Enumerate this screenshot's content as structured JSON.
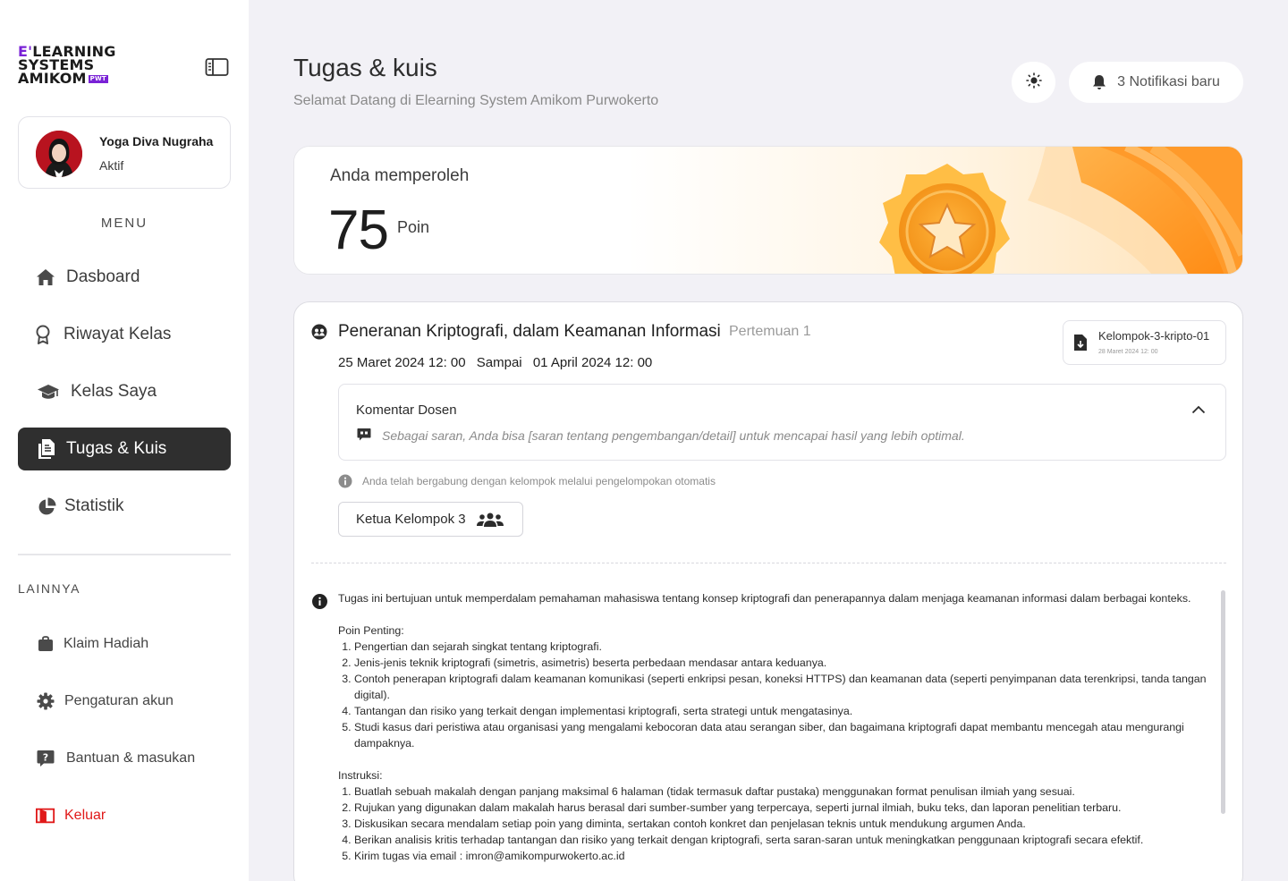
{
  "sidebar": {
    "logo": {
      "line1_prefix": "E'",
      "line1": "LEARNING",
      "line2": "SYSTEMS",
      "line3": "AMIKOM",
      "badge": "PWT"
    },
    "profile": {
      "name": "Yoga Diva Nugraha",
      "status": "Aktif"
    },
    "menu_title": "MENU",
    "nav": [
      {
        "label": "Dasboard",
        "icon": "home-icon"
      },
      {
        "label": "Riwayat Kelas",
        "icon": "award-icon"
      },
      {
        "label": "Kelas Saya",
        "icon": "graduation-cap-icon"
      },
      {
        "label": "Tugas & Kuis",
        "icon": "document-icon",
        "active": true
      },
      {
        "label": "Statistik",
        "icon": "pie-chart-icon"
      }
    ],
    "other_title": "LAINNYA",
    "other": [
      {
        "label": "Klaim Hadiah",
        "icon": "bag-icon"
      },
      {
        "label": "Pengaturan akun",
        "icon": "gear-icon"
      },
      {
        "label": "Bantuan & masukan",
        "icon": "help-icon"
      },
      {
        "label": "Keluar",
        "icon": "logout-icon"
      }
    ]
  },
  "header": {
    "title": "Tugas & kuis",
    "subtitle": "Selamat Datang di Elearning System Amikom Purwokerto",
    "notifications": "3 Notifikasi baru"
  },
  "points": {
    "label": "Anda memperoleh",
    "value": "75",
    "unit": "Poin"
  },
  "task": {
    "title": "Peneranan Kriptografi, dalam Keamanan Informasi",
    "meeting": "Pertemuan 1",
    "start": "25 Maret 2024 12: 00",
    "until": "Sampai",
    "end": "01 April 2024 12: 00",
    "file": {
      "name": "Kelompok-3-kripto-01",
      "date": "28 Maret 2024 12: 00"
    },
    "comment": {
      "title": "Komentar Dosen",
      "text": "Sebagai saran, Anda bisa [saran tentang pengembangan/detail]  untuk mencapai hasil yang lebih optimal."
    },
    "join_info": "Anda telah bergabung dengan kelompok melalui pengelompokan otomatis",
    "role": "Ketua Kelompok 3",
    "description": {
      "intro": "Tugas ini bertujuan untuk memperdalam pemahaman mahasiswa tentang konsep kriptografi dan penerapannya dalam menjaga keamanan informasi dalam berbagai konteks.",
      "points_title": "Poin Penting:",
      "points": [
        "Pengertian dan sejarah singkat tentang kriptografi.",
        "Jenis-jenis teknik kriptografi (simetris, asimetris) beserta perbedaan mendasar antara keduanya.",
        "Contoh penerapan kriptografi dalam keamanan komunikasi (seperti enkripsi pesan, koneksi HTTPS) dan keamanan data (seperti penyimpanan data terenkripsi, tanda tangan digital).",
        "Tantangan dan risiko yang terkait dengan implementasi kriptografi, serta strategi untuk mengatasinya.",
        "Studi kasus dari peristiwa atau organisasi yang mengalami kebocoran data atau serangan siber, dan bagaimana kriptografi dapat membantu mencegah atau mengurangi dampaknya."
      ],
      "instructions_title": "Instruksi:",
      "instructions": [
        "Buatlah sebuah makalah dengan panjang maksimal 6 halaman (tidak termasuk daftar pustaka) menggunakan format penulisan ilmiah yang sesuai.",
        "Rujukan yang digunakan dalam makalah harus berasal dari sumber-sumber yang terpercaya, seperti jurnal ilmiah, buku teks, dan laporan penelitian terbaru.",
        "Diskusikan secara mendalam setiap poin yang diminta, sertakan contoh konkret dan penjelasan teknis untuk mendukung argumen Anda.",
        "Berikan analisis kritis terhadap tantangan dan risiko yang terkait dengan kriptografi, serta saran-saran untuk meningkatkan penggunaan kriptografi secara efektif.",
        "Kirim tugas via email : imron@amikompurwokerto.ac.id"
      ]
    }
  },
  "colors": {
    "accent": "#7a22d6",
    "active_nav": "#2f2f2f",
    "logout": "#e01919",
    "medal": "#f59a1b"
  }
}
